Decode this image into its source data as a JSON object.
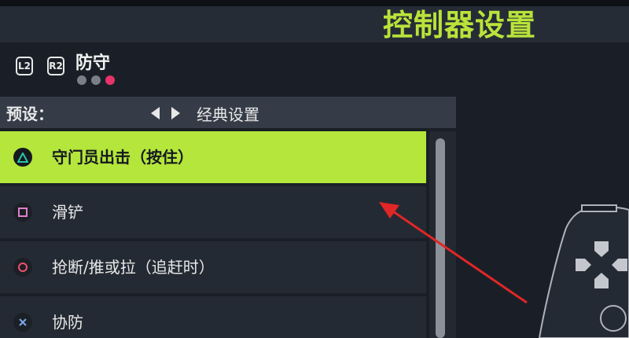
{
  "header": {
    "title": "控制器设置"
  },
  "tabs": {
    "buttons": [
      "L2",
      "R2"
    ],
    "current": "防守",
    "page_dots": [
      false,
      false,
      true
    ]
  },
  "preset": {
    "label": "预设：",
    "value": "经典设置"
  },
  "actions": [
    {
      "button_icon": "triangle-icon",
      "label": "守门员出击（按住）",
      "selected": true
    },
    {
      "button_icon": "square-icon",
      "label": "滑铲",
      "selected": false
    },
    {
      "button_icon": "circle-icon",
      "label": "抢断/推或拉（追赶时）",
      "selected": false
    },
    {
      "button_icon": "cross-icon",
      "label": "协防",
      "selected": false
    }
  ],
  "colors": {
    "accent": "#b5e63b",
    "title": "#b9e33a",
    "triangle": "#2bc3a6",
    "square": "#e080c8",
    "circle": "#f0506a",
    "cross": "#7aa8e8",
    "active_dot": "#e8336a",
    "annotation_arrow": "#e02626"
  }
}
